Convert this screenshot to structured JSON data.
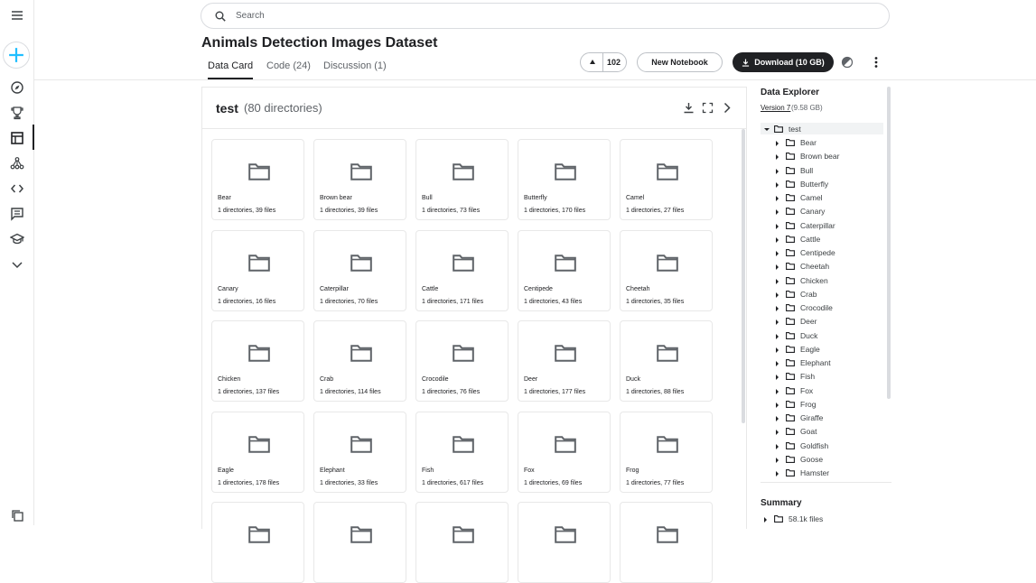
{
  "search": {
    "placeholder": "Search"
  },
  "dataset": {
    "title": "Animals Detection Images Dataset"
  },
  "tabs": [
    {
      "label": "Data Card"
    },
    {
      "label": "Code (24)"
    },
    {
      "label": "Discussion (1)"
    }
  ],
  "actions": {
    "upvotes": "102",
    "new_notebook": "New Notebook",
    "download": "Download (10 GB)"
  },
  "folder": {
    "name": "test",
    "count": "(80 directories)",
    "items": [
      {
        "name": "Bear",
        "meta": "1 directories, 39 files"
      },
      {
        "name": "Brown bear",
        "meta": "1 directories, 39 files"
      },
      {
        "name": "Bull",
        "meta": "1 directories, 73 files"
      },
      {
        "name": "Butterfly",
        "meta": "1 directories, 170 files"
      },
      {
        "name": "Camel",
        "meta": "1 directories, 27 files"
      },
      {
        "name": "Canary",
        "meta": "1 directories, 16 files"
      },
      {
        "name": "Caterpillar",
        "meta": "1 directories, 70 files"
      },
      {
        "name": "Cattle",
        "meta": "1 directories, 171 files"
      },
      {
        "name": "Centipede",
        "meta": "1 directories, 43 files"
      },
      {
        "name": "Cheetah",
        "meta": "1 directories, 35 files"
      },
      {
        "name": "Chicken",
        "meta": "1 directories, 137 files"
      },
      {
        "name": "Crab",
        "meta": "1 directories, 114 files"
      },
      {
        "name": "Crocodile",
        "meta": "1 directories, 76 files"
      },
      {
        "name": "Deer",
        "meta": "1 directories, 177 files"
      },
      {
        "name": "Duck",
        "meta": "1 directories, 88 files"
      },
      {
        "name": "Eagle",
        "meta": "1 directories, 178 files"
      },
      {
        "name": "Elephant",
        "meta": "1 directories, 33 files"
      },
      {
        "name": "Fish",
        "meta": "1 directories, 617 files"
      },
      {
        "name": "Fox",
        "meta": "1 directories, 69 files"
      },
      {
        "name": "Frog",
        "meta": "1 directories, 77 files"
      },
      {
        "name": "",
        "meta": ""
      },
      {
        "name": "",
        "meta": ""
      },
      {
        "name": "",
        "meta": ""
      },
      {
        "name": "",
        "meta": ""
      },
      {
        "name": "",
        "meta": ""
      }
    ]
  },
  "explorer": {
    "title": "Data Explorer",
    "version": "Version 7",
    "size": "(9.58 GB)",
    "root": "test",
    "children": [
      "Bear",
      "Brown bear",
      "Bull",
      "Butterfly",
      "Camel",
      "Canary",
      "Caterpillar",
      "Cattle",
      "Centipede",
      "Cheetah",
      "Chicken",
      "Crab",
      "Crocodile",
      "Deer",
      "Duck",
      "Eagle",
      "Elephant",
      "Fish",
      "Fox",
      "Frog",
      "Giraffe",
      "Goat",
      "Goldfish",
      "Goose",
      "Hamster"
    ]
  },
  "summary": {
    "title": "Summary",
    "files": "58.1k files"
  },
  "rail": {
    "icons": [
      "menu-icon",
      "create-icon",
      "explore-icon",
      "competitions-icon",
      "datasets-icon",
      "models-icon",
      "code-icon",
      "discussions-icon",
      "learn-icon",
      "more-icon",
      "recent-icon"
    ]
  },
  "colors": {
    "accent": "#20beff",
    "dark": "#202124",
    "border": "#e8e8e8"
  }
}
